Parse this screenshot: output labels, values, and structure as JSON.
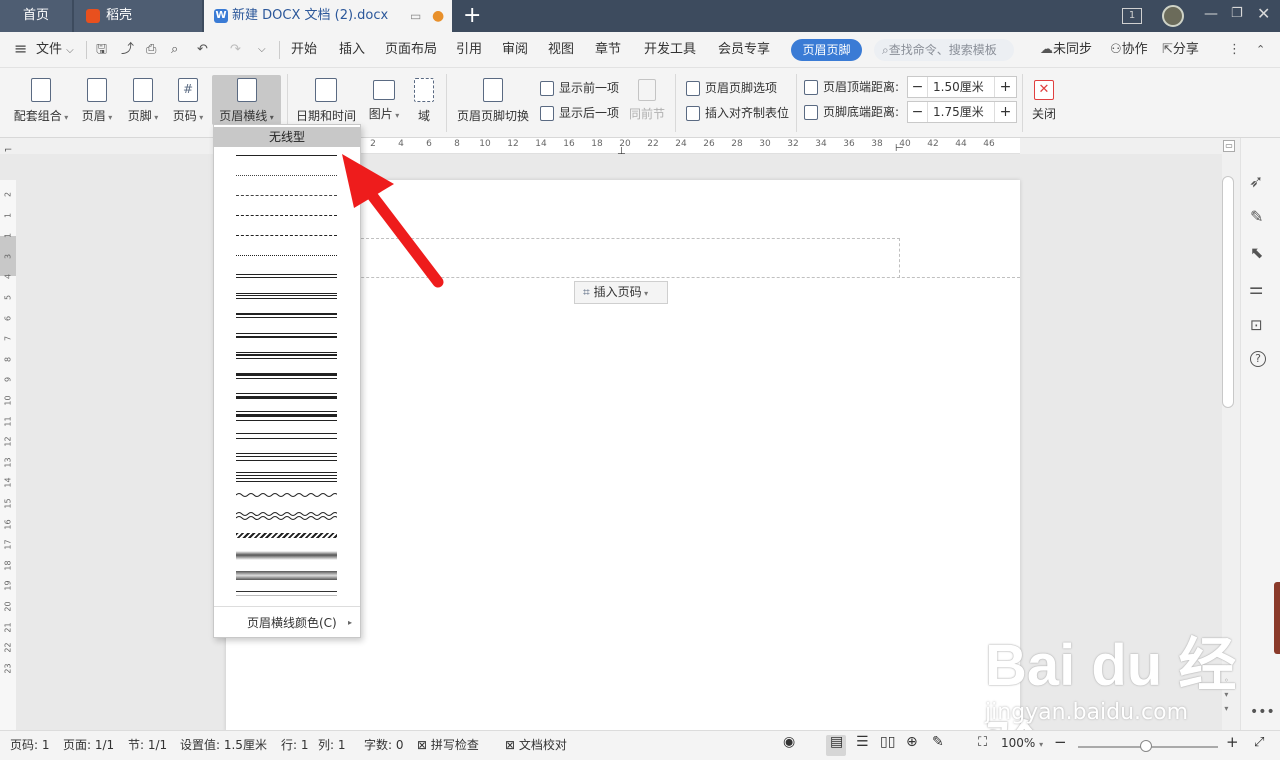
{
  "tabs": {
    "home": "首页",
    "daoke": "稻壳",
    "doc": "新建 DOCX 文档 (2).docx"
  },
  "menu": {
    "file": "文件",
    "items": [
      "开始",
      "插入",
      "页面布局",
      "引用",
      "审阅",
      "视图",
      "章节",
      "开发工具",
      "会员专享"
    ],
    "active": "页眉页脚",
    "search_placeholder": "查找命令、搜索模板",
    "sync": "未同步",
    "collab": "协作",
    "share": "分享"
  },
  "ribbon": {
    "combo": "配套组合",
    "header": "页眉",
    "footer": "页脚",
    "pagenum": "页码",
    "header_line": "页眉横线",
    "datetime": "日期和时间",
    "picture": "图片",
    "field": "域",
    "switch": "页眉页脚切换",
    "show_prev": "显示前一项",
    "show_next": "显示后一项",
    "same_prev": "同前节",
    "hf_options": "页眉页脚选项",
    "insert_align": "插入对齐制表位",
    "top_dist_label": "页眉顶端距离:",
    "top_dist_value": "1.50厘米",
    "bottom_dist_label": "页脚底端距离:",
    "bottom_dist_value": "1.75厘米",
    "close": "关闭"
  },
  "dropdown": {
    "title": "无线型",
    "color_item": "页眉横线颜色(C)"
  },
  "ruler": {
    "h_ticks": [
      "2",
      "4",
      "6",
      "8",
      "10",
      "12",
      "14",
      "16",
      "18",
      "20",
      "22",
      "24",
      "26",
      "28",
      "30",
      "32",
      "34",
      "36",
      "38",
      "40",
      "42",
      "44",
      "46"
    ],
    "v_ticks": [
      "2",
      "1",
      "1",
      "3",
      "4",
      "5",
      "6",
      "7",
      "8",
      "9",
      "10",
      "11",
      "12",
      "13",
      "14",
      "15",
      "16",
      "17",
      "18",
      "19",
      "20",
      "21",
      "22",
      "23"
    ]
  },
  "page": {
    "insert_pagenum": "插入页码"
  },
  "status": {
    "page": "页码: 1",
    "pages": "页面: 1/1",
    "section": "节: 1/1",
    "setting": "设置值: 1.5厘米",
    "row": "行: 1",
    "col": "列: 1",
    "words": "字数: 0",
    "spell": "拼写检查",
    "proof": "文档校对",
    "zoom": "100%"
  },
  "watermark": {
    "brand": "Bai du 经验",
    "url": "jingyan.baidu.com"
  },
  "colors": {
    "titlebar": "#3d4b5e",
    "accent": "#3a7bd5",
    "arrow": "#ee1c1c"
  }
}
